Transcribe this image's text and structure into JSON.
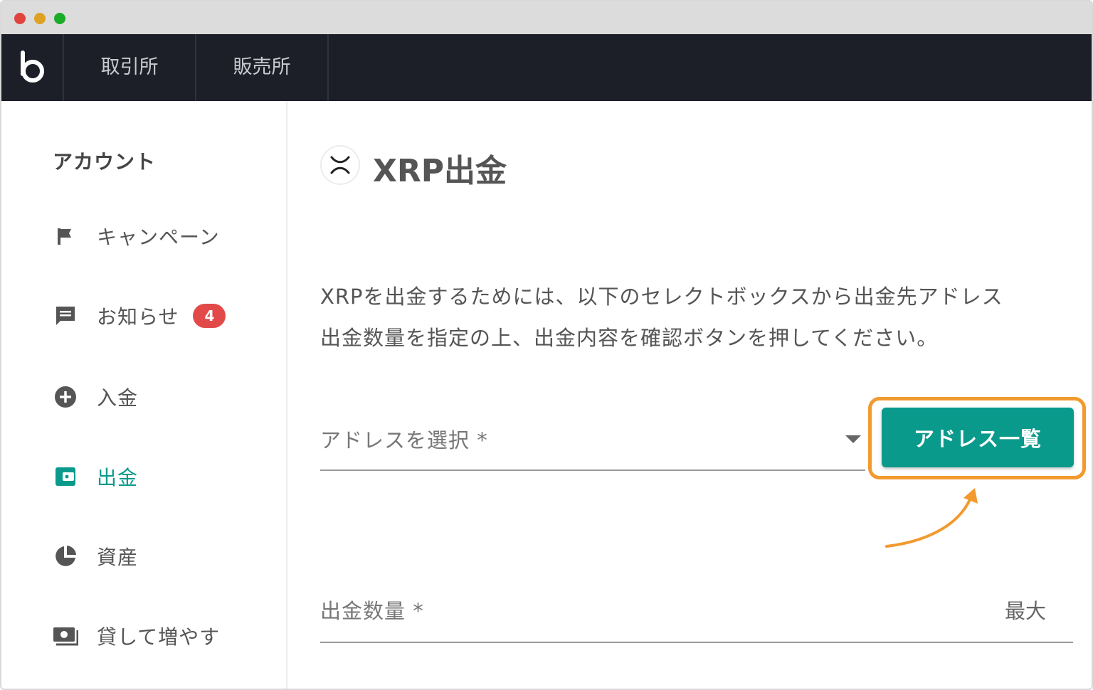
{
  "topnav": {
    "tabs": [
      {
        "label": "取引所"
      },
      {
        "label": "販売所"
      }
    ]
  },
  "sidebar": {
    "title": "アカウント",
    "items": [
      {
        "label": "キャンペーン",
        "icon": "flag-icon"
      },
      {
        "label": "お知らせ",
        "icon": "message-icon",
        "badge": "4"
      },
      {
        "label": "入金",
        "icon": "plus-circle-icon"
      },
      {
        "label": "出金",
        "icon": "wallet-icon",
        "active": true
      },
      {
        "label": "資産",
        "icon": "pie-chart-icon"
      },
      {
        "label": "貸して増やす",
        "icon": "money-icon"
      }
    ]
  },
  "main": {
    "title": "XRP出金",
    "description_line1": "XRPを出金するためには、以下のセレクトボックスから出金先アドレス",
    "description_line2": "出金数量を指定の上、出金内容を確認ボタンを押してください。",
    "address_select_label": "アドレスを選択 *",
    "address_list_button": "アドレス一覧",
    "amount_label": "出金数量 *",
    "max_label": "最大"
  },
  "colors": {
    "accent": "#0a9a8c",
    "highlight": "#f29a2e",
    "badge": "#e24a4a",
    "nav_bg": "#1c1f27"
  }
}
